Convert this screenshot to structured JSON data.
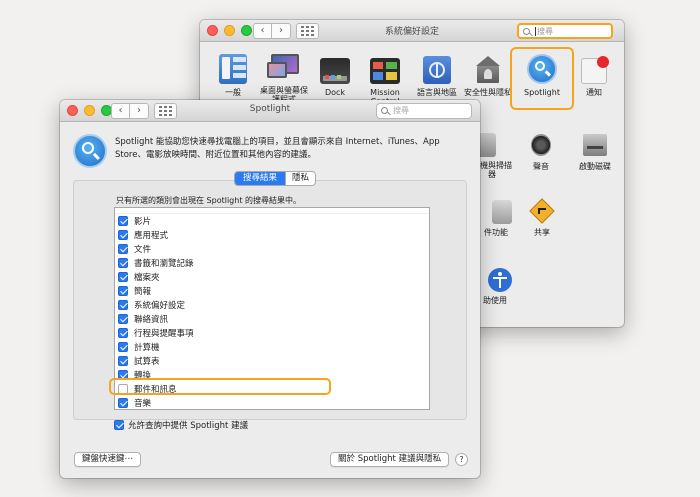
{
  "back_window": {
    "title": "系統偏好設定",
    "search_placeholder": "搜尋",
    "row1": [
      {
        "icon": "general-icon",
        "label": "一般"
      },
      {
        "icon": "desktop-screensaver-icon",
        "label": "桌面與螢幕保護程式"
      },
      {
        "icon": "dock-icon",
        "label": "Dock"
      },
      {
        "icon": "mission-control-icon",
        "label": "Mission Control"
      },
      {
        "icon": "language-region-icon",
        "label": "語言與地區"
      },
      {
        "icon": "security-privacy-icon",
        "label": "安全性與隱私"
      },
      {
        "icon": "spotlight-icon",
        "label": "Spotlight"
      },
      {
        "icon": "notifications-icon",
        "label": "通知"
      }
    ],
    "row2_partial": [
      {
        "icon": "printers-scanners-icon",
        "label": "表機與掃描器"
      },
      {
        "icon": "sound-icon",
        "label": "聲音"
      },
      {
        "icon": "startup-disk-icon",
        "label": "啟動磁碟"
      }
    ],
    "row3_partial": [
      {
        "icon": "sharing-icon",
        "label": "共享"
      },
      {
        "icon": "other-pane-icon",
        "label": "件功能"
      }
    ],
    "row4_partial": [
      {
        "icon": "accessibility-icon",
        "label": "助使用"
      }
    ]
  },
  "front_window": {
    "title": "Spotlight",
    "search_placeholder": "搜尋",
    "description": "Spotlight 能協助您快速尋找電腦上的項目，並且會顯示來自 Internet、iTunes、App Store、電影放映時間、附近位置和其他內容的建議。",
    "tabs": [
      {
        "label": "搜尋結果",
        "selected": true
      },
      {
        "label": "隱私",
        "selected": false
      }
    ],
    "list_intro": "只有所選的類別會出現在 Spotlight 的搜尋結果中。",
    "categories": [
      {
        "label": "影片",
        "checked": true
      },
      {
        "label": "應用程式",
        "checked": true
      },
      {
        "label": "文件",
        "checked": true
      },
      {
        "label": "書籤和瀏覽記錄",
        "checked": true
      },
      {
        "label": "檔案夾",
        "checked": true
      },
      {
        "label": "簡報",
        "checked": true
      },
      {
        "label": "系統偏好設定",
        "checked": true
      },
      {
        "label": "聯絡資訊",
        "checked": true
      },
      {
        "label": "行程與提醒事項",
        "checked": true
      },
      {
        "label": "計算機",
        "checked": true
      },
      {
        "label": "試算表",
        "checked": true
      },
      {
        "label": "轉換",
        "checked": true
      },
      {
        "label": "郵件和訊息",
        "checked": false
      },
      {
        "label": "音樂",
        "checked": true
      }
    ],
    "allow_suggestions_label": "允許查詢中提供 Spotlight 建議",
    "allow_suggestions_checked": true,
    "keyboard_shortcuts_button": "鍵盤快速鍵⋯",
    "about_button": "關於 Spotlight 建議與隱私",
    "help_button": "?"
  },
  "colors": {
    "highlight": "#f5a41e",
    "accent": "#2a7af1"
  }
}
